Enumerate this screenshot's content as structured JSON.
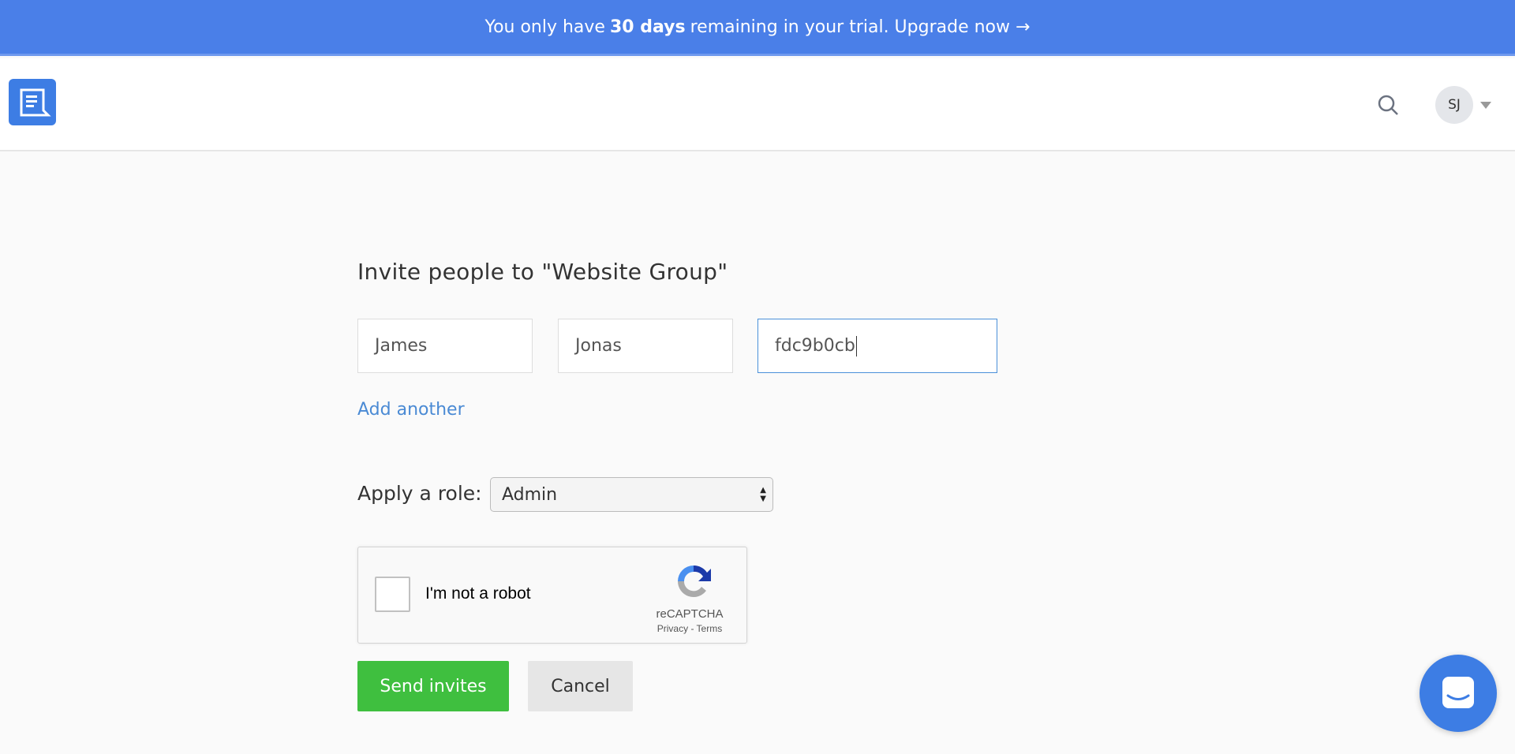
{
  "banner": {
    "prefix": "You only have",
    "highlight": "30 days",
    "suffix": "remaining in your trial. Upgrade now →"
  },
  "header": {
    "logo_icon": "chat-document-icon",
    "search_icon": "search-icon",
    "avatar_initials": "SJ",
    "caret_icon": "caret-down-icon"
  },
  "form": {
    "title": "Invite people to \"Website Group\"",
    "inputs": [
      {
        "value": "James"
      },
      {
        "value": "Jonas"
      },
      {
        "value": "fdc9b0cb"
      }
    ],
    "add_another": "Add another",
    "role_label": "Apply a role:",
    "role_value": "Admin",
    "captcha": {
      "label": "I'm not a robot",
      "brand": "reCAPTCHA",
      "terms": "Privacy - Terms"
    },
    "send_label": "Send invites",
    "cancel_label": "Cancel"
  },
  "colors": {
    "accent": "#4a7fe8",
    "send": "#3fbf3f",
    "link": "#4a8ad4"
  }
}
